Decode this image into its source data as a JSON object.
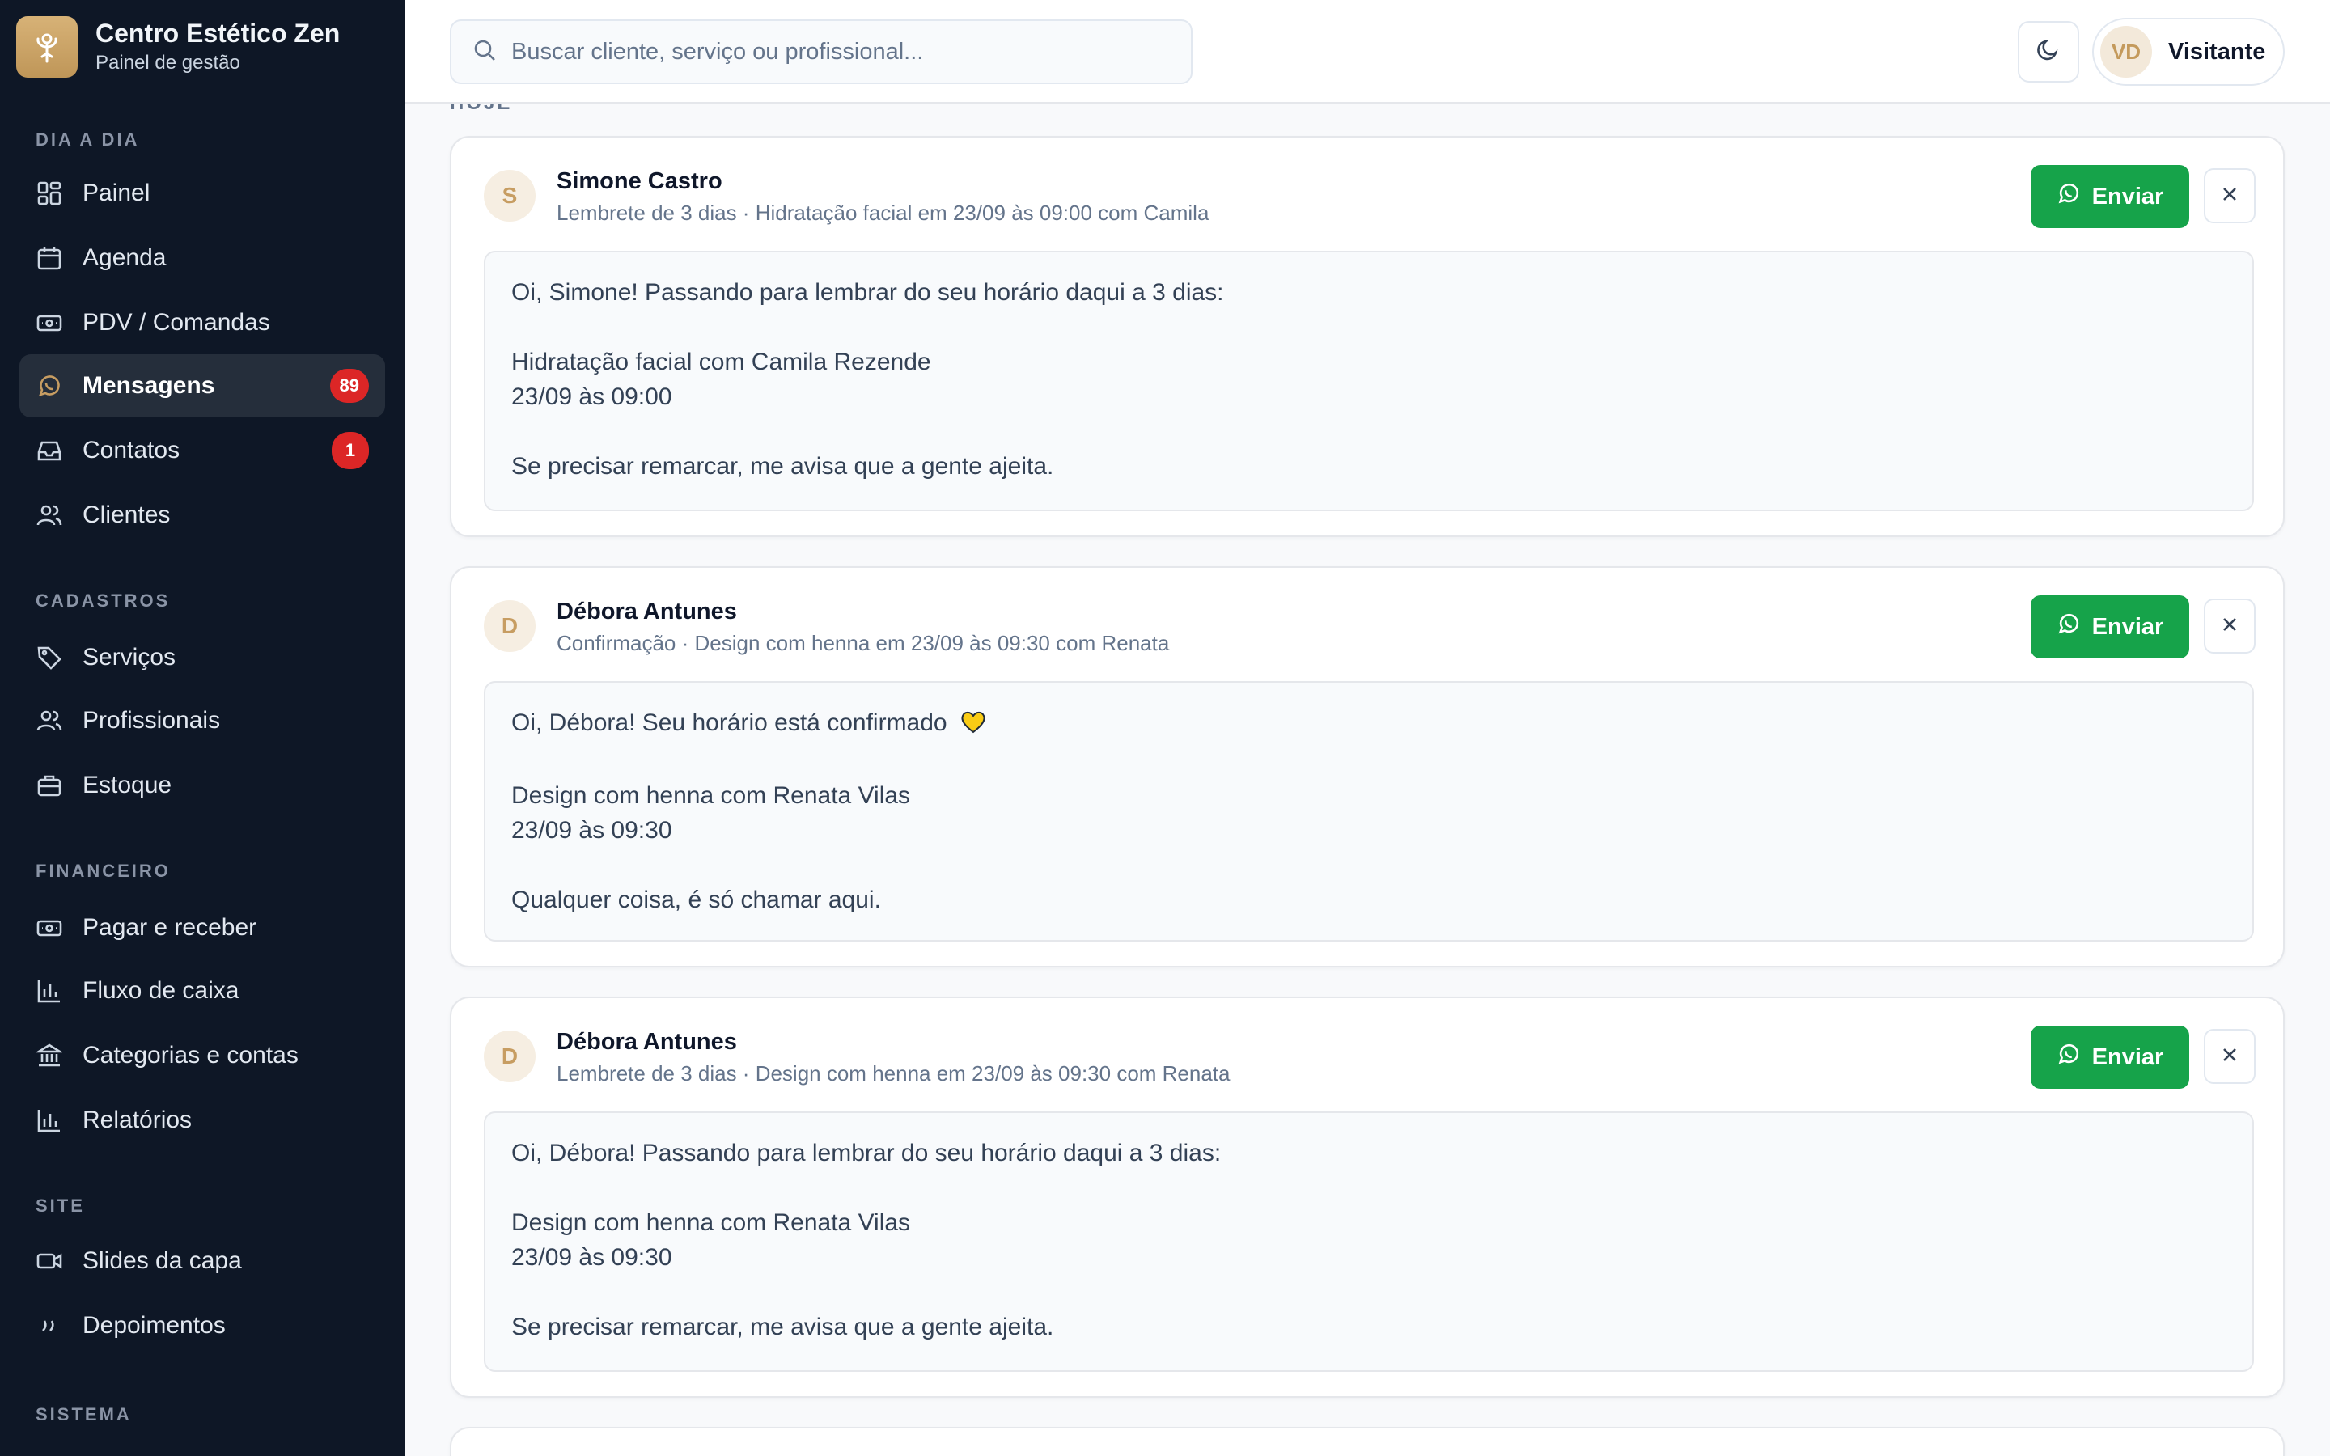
{
  "brand": {
    "title": "Centro Estético Zen",
    "subtitle": "Painel de gestão"
  },
  "sidebar": {
    "sections": [
      {
        "label": "DIA A DIA"
      },
      {
        "label": "CADASTROS"
      },
      {
        "label": "FINANCEIRO"
      },
      {
        "label": "SITE"
      },
      {
        "label": "SISTEMA"
      }
    ],
    "items": [
      {
        "label": "Painel",
        "icon": "grid-icon"
      },
      {
        "label": "Agenda",
        "icon": "calendar-icon"
      },
      {
        "label": "PDV / Comandas",
        "icon": "cash-icon"
      },
      {
        "label": "Mensagens",
        "icon": "whatsapp-icon",
        "badge": "89",
        "active": true
      },
      {
        "label": "Contatos",
        "icon": "inbox-icon",
        "badge": "1"
      },
      {
        "label": "Clientes",
        "icon": "users-icon"
      },
      {
        "label": "Serviços",
        "icon": "tag-icon"
      },
      {
        "label": "Profissionais",
        "icon": "users-icon"
      },
      {
        "label": "Estoque",
        "icon": "briefcase-icon"
      },
      {
        "label": "Pagar e receber",
        "icon": "cash-icon"
      },
      {
        "label": "Fluxo de caixa",
        "icon": "bar-chart-icon"
      },
      {
        "label": "Categorias e contas",
        "icon": "bank-icon"
      },
      {
        "label": "Relatórios",
        "icon": "bar-chart-icon"
      },
      {
        "label": "Slides da capa",
        "icon": "video-icon"
      },
      {
        "label": "Depoimentos",
        "icon": "quote-icon"
      }
    ]
  },
  "header": {
    "search_placeholder": "Buscar cliente, serviço ou profissional...",
    "user_initials": "VD",
    "user_name": "Visitante"
  },
  "main": {
    "section_label": "HOJE",
    "send_label": "Enviar",
    "messages": [
      {
        "initial": "S",
        "name": "Simone Castro",
        "meta": "Lembrete de 3 dias · Hidratação facial em 23/09 às 09:00 com Camila",
        "line1": "Oi, Simone! Passando para lembrar do seu horário daqui a 3 dias:",
        "line2": "Hidratação facial com Camila Rezende",
        "line3": "23/09 às 09:00",
        "line4": "Se precisar remarcar, me avisa que a gente ajeita."
      },
      {
        "initial": "D",
        "name": "Débora Antunes",
        "meta": "Confirmação · Design com henna em 23/09 às 09:30 com Renata",
        "line1": "Oi, Débora! Seu horário está confirmado",
        "line2": "Design com henna com Renata Vilas",
        "line3": "23/09 às 09:30",
        "line4": "Qualquer coisa, é só chamar aqui."
      },
      {
        "initial": "D",
        "name": "Débora Antunes",
        "meta": "Lembrete de 3 dias · Design com henna em 23/09 às 09:30 com Renata",
        "line1": "Oi, Débora! Passando para lembrar do seu horário daqui a 3 dias:",
        "line2": "Design com henna com Renata Vilas",
        "line3": "23/09 às 09:30",
        "line4": "Se precisar remarcar, me avisa que a gente ajeita."
      }
    ]
  },
  "colors": {
    "accent": "#16a34a",
    "badge": "#dc2626",
    "sidebar": "#0e1726",
    "brand": "#c79d62"
  }
}
